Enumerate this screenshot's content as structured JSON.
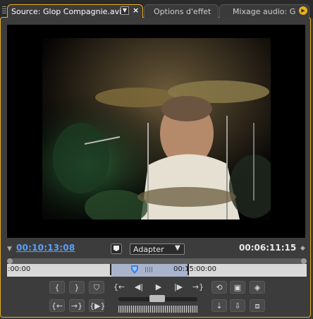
{
  "tabs": {
    "source_label": "Source: Glop Compagnie.avi",
    "effects_label": "Options d'effet",
    "mixer_label": "Mixage audio: G"
  },
  "timecode": {
    "current": "00:10:13:08",
    "duration": "00:06:11:15"
  },
  "zoom": {
    "selected": "Adapter"
  },
  "ruler": {
    "start_label": ":00:00",
    "mid_label": "00:15:00:00",
    "in_out_range": "highlighted"
  },
  "colors": {
    "accent": "#e8b020",
    "timecode_blue": "#5aa0ff",
    "ruler_inout": "#a9b4cc"
  },
  "transport": {
    "row1": [
      "mark-in-icon",
      "mark-out-icon",
      "set-marker-icon",
      "step-back-to-in-icon",
      "step-back-icon",
      "play-icon",
      "step-forward-icon",
      "step-forward-to-out-icon",
      "loop-icon",
      "safe-margins-icon",
      "output-icon"
    ],
    "row2": [
      "go-to-in-icon",
      "go-to-out-icon",
      "play-in-to-out-icon",
      "jog-slider",
      "shuttle",
      "insert-icon",
      "overlay-icon",
      "export-frame-icon"
    ]
  }
}
